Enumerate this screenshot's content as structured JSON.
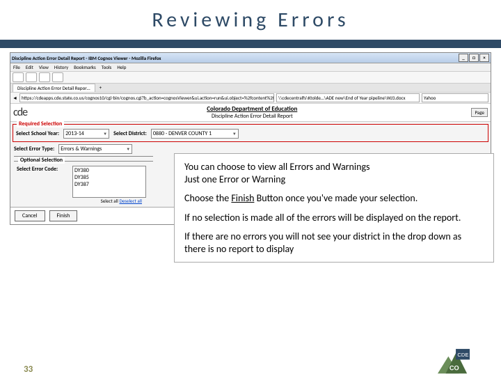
{
  "slide": {
    "title": "Reviewing Errors",
    "page_number": "33"
  },
  "browser": {
    "window_title": "Discipline Action Error Detail Report - IBM Cognos Viewer - Mozilla Firefox",
    "menu": [
      "File",
      "Edit",
      "View",
      "History",
      "Bookmarks",
      "Tools",
      "Help"
    ],
    "tab_label": "Discipline Action Error Detail Repor…",
    "url": "https://cdeapps.cde.state.co.us/cognos10/cgi-bin/cognos.cgi?b_action=cognosViewer&ui.action=run&ui.object=%2fcontent%2ffolder…",
    "bookmark_path": "\\\\cdecentralfs\\Ktolde…\\ADE new\\End of Year pipeline\\WJ3.docx",
    "search_engine": "Yahoo",
    "window_controls": {
      "min": "_",
      "max": "□",
      "close": "×"
    }
  },
  "report": {
    "logo_text": "cde",
    "title_line1": "Colorado Department of Education",
    "title_line2": "Discipline Action Error Detail Report",
    "page_link": "Page",
    "required_legend": "Required Selection",
    "year_label": "Select School Year:",
    "year_value": "2013-14",
    "district_label": "Select District:",
    "district_value": "0880 - DENVER COUNTY 1",
    "errortype_label": "Select Error Type:",
    "errortype_value": "Errors & Warnings",
    "optional_legend": "Optional Selection",
    "errorcode_label": "Select Error Code:",
    "error_codes": [
      "DY380",
      "DY385",
      "DY387"
    ],
    "deselect_prefix": "Select all ",
    "deselect_link": "Deselect all",
    "cancel_label": "Cancel",
    "finish_label": "Finish"
  },
  "callout": {
    "p1a": "You can choose to view all Errors and Warnings",
    "p1b": "Just one Error or Warning",
    "p2a": "Choose the ",
    "p2_finish": "Finish",
    "p2b": " Button once you've made your selection.",
    "p3": "If no selection is made all of the errors will be displayed on the report.",
    "p4": "If there are no errors you will not see your district in the drop down as there is no report to display"
  }
}
